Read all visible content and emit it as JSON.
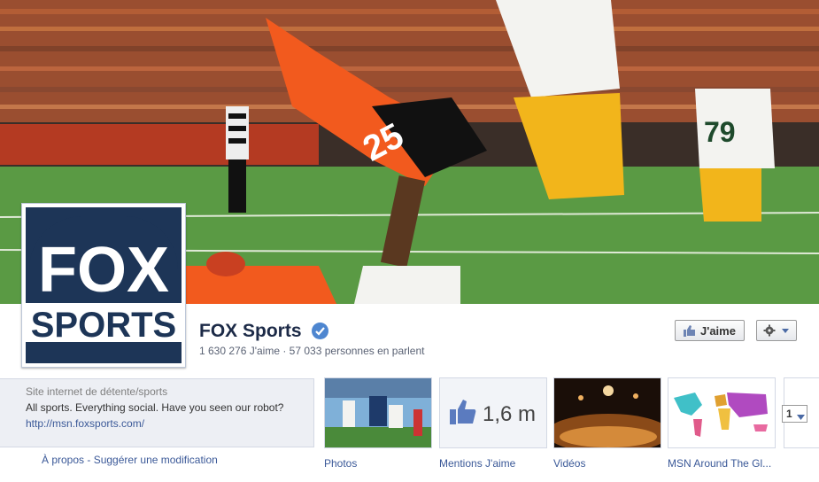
{
  "page": {
    "name": "FOX Sports",
    "stats": "1 630 276 J'aime · 57 033 personnes en parlent",
    "logo_line1": "FOX",
    "logo_line2": "SPORTS"
  },
  "actions": {
    "like_label": "J'aime"
  },
  "cover": {
    "jersey_left": "25",
    "jersey_right": "79"
  },
  "about": {
    "category": "Site internet de détente/sports",
    "description": "All sports. Everything social. Have you seen our robot?",
    "link": "http://msn.foxsports.com/",
    "about_link": "À propos",
    "suggest_link": "Suggérer une modification",
    "separator": " - "
  },
  "apps": {
    "photos_label": "Photos",
    "likes_label": "Mentions J'aime",
    "likes_count": "1,6 m",
    "videos_label": "Vidéos",
    "msn_label": "MSN Around The Gl...",
    "more_count": "1"
  },
  "colors": {
    "link": "#3b5998",
    "verified": "#4e86d0",
    "fox_blue": "#1d3557"
  },
  "icons": {
    "verified": "verified-badge-icon",
    "like": "thumbs-up-icon",
    "gear": "gear-icon",
    "caret": "caret-down-icon"
  }
}
